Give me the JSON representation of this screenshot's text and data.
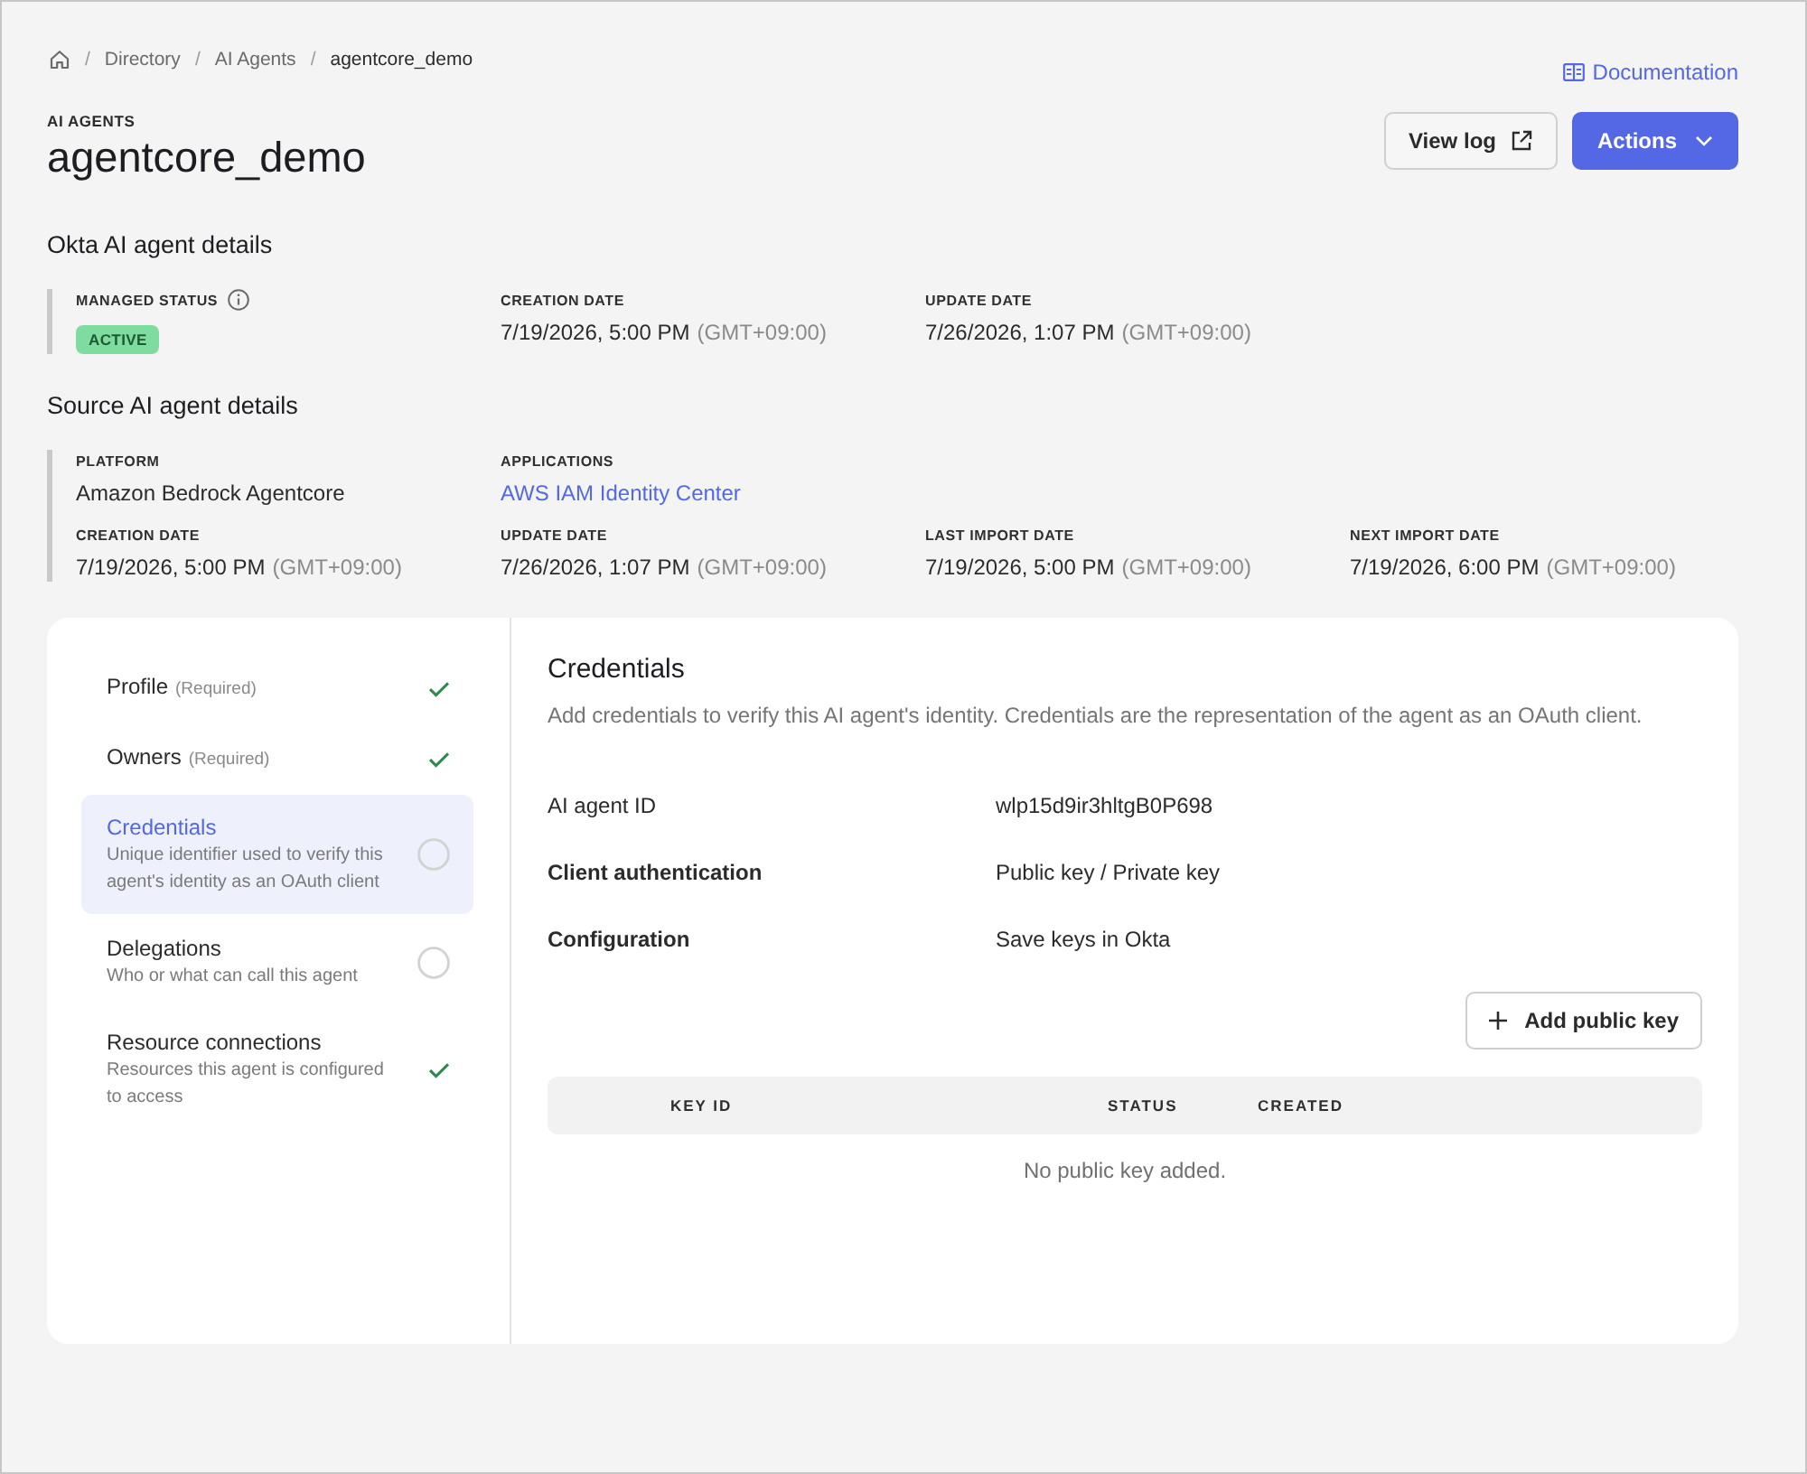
{
  "breadcrumb": {
    "separator": "/",
    "items": [
      {
        "label": "Directory",
        "current": false
      },
      {
        "label": "AI Agents",
        "current": false
      },
      {
        "label": "agentcore_demo",
        "current": true
      }
    ]
  },
  "documentation_link": "Documentation",
  "header": {
    "eyebrow": "AI AGENTS",
    "title": "agentcore_demo",
    "buttons": [
      {
        "label": "View log",
        "kind": "external"
      },
      {
        "label": "Actions",
        "kind": "menu"
      }
    ]
  },
  "okta_details": {
    "heading": "Okta AI agent details",
    "rows": [
      [
        {
          "label": "MANAGED STATUS",
          "kind": "status",
          "value": "ACTIVE",
          "info": true
        },
        {
          "label": "CREATION DATE",
          "kind": "date",
          "value": "7/19/2026, 5:00 PM",
          "zone": "(GMT+09:00)",
          "info": false
        },
        {
          "label": "UPDATE DATE",
          "kind": "date",
          "value": "7/26/2026, 1:07 PM",
          "zone": "(GMT+09:00)",
          "info": false
        }
      ]
    ]
  },
  "source_details": {
    "heading": "Source AI agent details",
    "rows": [
      [
        {
          "label": "PLATFORM",
          "kind": "text",
          "value": "Amazon Bedrock Agentcore",
          "info": false
        },
        {
          "label": "APPLICATIONS",
          "kind": "link",
          "value": "AWS IAM Identity Center",
          "info": false
        }
      ],
      [
        {
          "label": "CREATION DATE",
          "kind": "date",
          "value": "7/19/2026, 5:00 PM",
          "zone": "(GMT+09:00)",
          "info": false
        },
        {
          "label": "UPDATE DATE",
          "kind": "date",
          "value": "7/26/2026, 1:07 PM",
          "zone": "(GMT+09:00)",
          "info": false
        },
        {
          "label": "LAST IMPORT DATE",
          "kind": "date",
          "value": "7/19/2026, 5:00 PM",
          "zone": "(GMT+09:00)",
          "info": false
        },
        {
          "label": "NEXT IMPORT DATE",
          "kind": "date",
          "value": "7/19/2026, 6:00 PM",
          "zone": "(GMT+09:00)",
          "info": false
        }
      ]
    ]
  },
  "steps": [
    {
      "title": "Profile",
      "note": "(Required)",
      "complete": true,
      "selected": false
    },
    {
      "title": "Owners",
      "note": "(Required)",
      "complete": true,
      "selected": false
    },
    {
      "title": "Credentials",
      "description": "Unique identifier used to verify this agent's identity as an OAuth client",
      "complete": false,
      "selected": true
    },
    {
      "title": "Delegations",
      "description": "Who or what can call this agent",
      "complete": false,
      "selected": false
    },
    {
      "title": "Resource connections",
      "description": "Resources this agent is configured to access",
      "complete": true,
      "selected": false
    }
  ],
  "credentials": {
    "title": "Credentials",
    "description": "Add credentials to verify this AI agent's identity. Credentials are the representation of the agent as an OAuth client.",
    "fields": [
      {
        "label": "AI agent ID",
        "value": "wlp15d9ir3hltgB0P698",
        "emphasis": false
      },
      {
        "label": "Client authentication",
        "value": "Public key / Private key",
        "emphasis": true
      },
      {
        "label": "Configuration",
        "value": "Save keys in Okta",
        "emphasis": true
      }
    ],
    "add_button": "Add public key",
    "table": {
      "columns": [
        "KEY ID",
        "STATUS",
        "CREATED"
      ],
      "empty_message": "No public key added."
    }
  }
}
